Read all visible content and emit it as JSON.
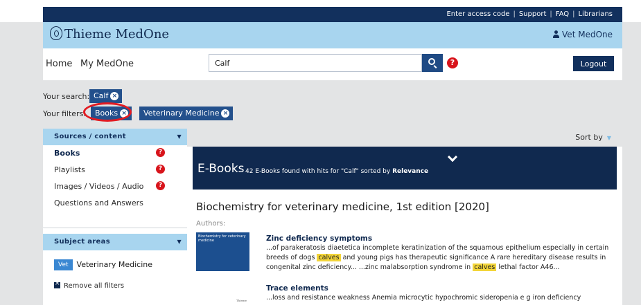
{
  "topbar": {
    "links": [
      "Enter access code",
      "Support",
      "FAQ",
      "Librarians"
    ]
  },
  "brand": {
    "logo_text": "Thieme MedOne",
    "user_label": "Vet MedOne"
  },
  "nav": {
    "home": "Home",
    "my_medone": "My MedOne",
    "search_value": "Calf",
    "help_symbol": "?",
    "logout": "Logout"
  },
  "search_summary": {
    "your_search_label": "Your search:",
    "search_term": "Calf",
    "your_filters_label": "Your filters:",
    "filters": [
      "Books",
      "Veterinary Medicine"
    ],
    "remove_symbol": "×"
  },
  "sidebar": {
    "sources_header": "Sources / content",
    "sources": [
      {
        "label": "Books",
        "has_help": true
      },
      {
        "label": "Playlists",
        "has_help": true
      },
      {
        "label": "Images / Videos / Audio",
        "has_help": true
      },
      {
        "label": "Questions and Answers",
        "has_help": false
      }
    ],
    "subject_header": "Subject areas",
    "subject_badge": "Vet",
    "subject_label": "Veterinary Medicine",
    "remove_all": "Remove all filters"
  },
  "results": {
    "sort_label": "Sort by",
    "banner_title": "E-Books",
    "count_prefix": "42 E-Books found with hits for \"Calf\" sorted by",
    "sort_value": "Relevance",
    "book_title": "Biochemistry for veterinary medicine, 1st edition [2020]",
    "authors_label": "Authors:",
    "cover_text": "Biochemistry for veterinary medicine",
    "cover_publisher": "Thieme",
    "hits": [
      {
        "title": "Zinc deficiency symptoms",
        "seg1": "...of parakeratosis diaetetica incomplete keratinization of the squamous epithelium especially in certain breeds of dogs",
        "hl1": "calves",
        "seg2": "and young pigs has therapeutic significance A rare hereditary disease results in congenital zinc deficiency... ...zinc malabsorption syndrome in",
        "hl2": "calves",
        "seg3": "lethal factor A46..."
      },
      {
        "title": "Trace elements",
        "text": "...loss and resistance weakness Anemia microcytic hypochromic sideropenia e g iron deficiency"
      }
    ]
  },
  "colors": {
    "navy": "#10294f",
    "light_blue": "#a8d5ef",
    "tag_blue": "#23508c",
    "help_red": "#d8141b",
    "highlight_yellow": "#f3d539"
  }
}
